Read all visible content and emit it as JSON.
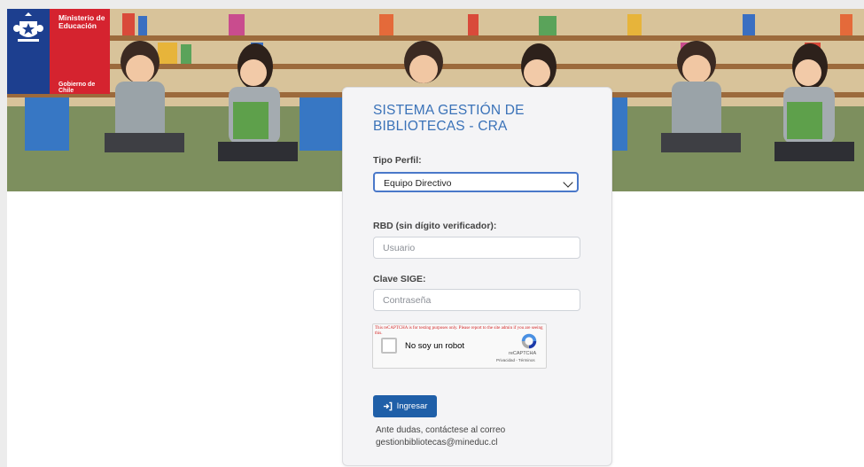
{
  "logo": {
    "ministry": "Ministerio de Educación",
    "government": "Gobierno de Chile"
  },
  "form": {
    "title": "SISTEMA GESTIÓN DE BIBLIOTECAS - CRA",
    "profile_label": "Tipo Perfil:",
    "profile_selected": "Equipo Directivo",
    "rbd_label": "RBD (sin dígito verificador):",
    "rbd_placeholder": "Usuario",
    "password_label": "Clave SIGE:",
    "password_placeholder": "Contraseña",
    "submit_label": "Ingresar",
    "help_line1": "Ante dudas, contáctese al correo",
    "help_email": "gestionbibliotecas@mineduc.cl"
  },
  "recaptcha": {
    "warning": "This reCAPTCHA is for testing purposes only. Please report to the site admin if you are seeing this.",
    "label": "No soy un robot",
    "brand": "reCAPTCHA",
    "links": "Privacidad - Términos"
  },
  "colors": {
    "accent": "#3a72b8",
    "button": "#1f5fa8",
    "logo_blue": "#1d3f8f",
    "logo_red": "#d5232f"
  }
}
